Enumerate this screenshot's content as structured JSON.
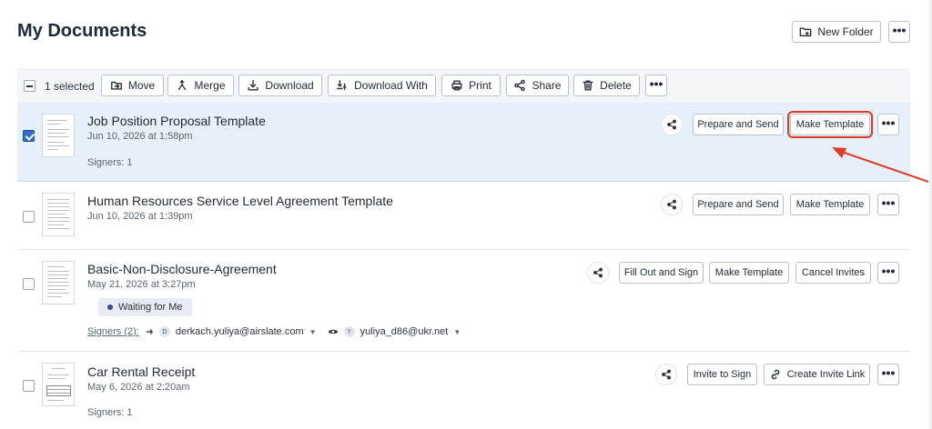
{
  "page": {
    "title": "My Documents",
    "new_folder_label": "New Folder",
    "more_glyph": "•••"
  },
  "toolbar": {
    "selected_text": "1 selected",
    "move_label": "Move",
    "merge_label": "Merge",
    "download_label": "Download",
    "download_with_label": "Download With",
    "print_label": "Print",
    "share_label": "Share",
    "delete_label": "Delete"
  },
  "documents": [
    {
      "title": "Job Position Proposal Template",
      "date": "Jun 10, 2026 at 1:58pm",
      "signers": "Signers: 1",
      "selected": true,
      "actions": [
        "Prepare and Send",
        "Make Template"
      ]
    },
    {
      "title": "Human Resources Service Level Agreement Template",
      "date": "Jun 10, 2026 at 1:39pm",
      "selected": false,
      "actions": [
        "Prepare and Send",
        "Make Template"
      ]
    },
    {
      "title": "Basic-Non-Disclosure-Agreement",
      "date": "May 21, 2026 at 3:27pm",
      "status": "Waiting for Me",
      "signers_label": "Signers (2):",
      "signer1_initial": "D",
      "signer1_email": "derkach.yuliya@airslate.com",
      "signer2_initial": "Y",
      "signer2_email": "yuliya_d86@ukr.net",
      "selected": false,
      "actions": [
        "Fill Out and Sign",
        "Make Template",
        "Cancel Invites"
      ]
    },
    {
      "title": "Car Rental Receipt",
      "date": "May 6, 2026 at 2:20am",
      "signers": "Signers: 1",
      "selected": false,
      "actions": [
        "Invite to Sign",
        "Create Invite Link"
      ]
    }
  ],
  "annotation": {
    "highlight_color": "#e13b26",
    "accent_color": "#2f6fc9"
  },
  "icons": [
    "folder-plus-icon",
    "move-icon",
    "merge-icon",
    "download-icon",
    "download-with-icon",
    "print-icon",
    "share-icon",
    "trash-icon",
    "link-icon",
    "eye-icon",
    "arrow-right-icon"
  ]
}
